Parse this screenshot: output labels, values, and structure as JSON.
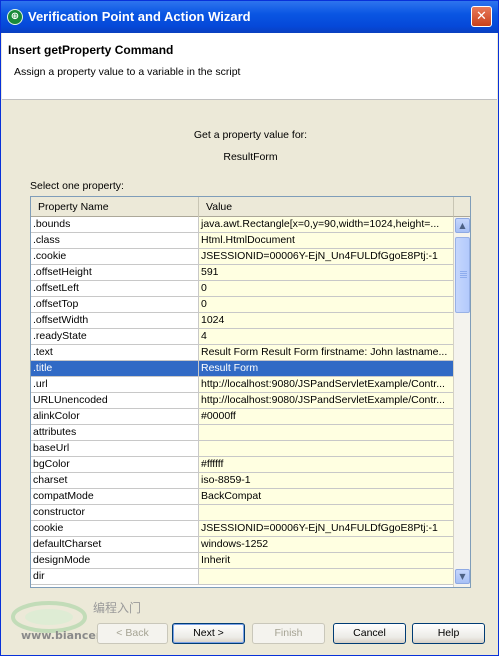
{
  "window": {
    "title": "Verification Point and Action Wizard",
    "close_glyph": "✕",
    "app_icon": "wizard-globe-icon"
  },
  "header": {
    "heading": "Insert getProperty Command",
    "description": "Assign a property value to a variable in the script"
  },
  "main": {
    "prompt": "Get a property value for:",
    "object_name": "ResultForm",
    "select_label": "Select one property:"
  },
  "table": {
    "columns": [
      "Property Name",
      "Value"
    ],
    "selected_index": 9,
    "rows": [
      {
        "name": ".bounds",
        "value": "java.awt.Rectangle[x=0,y=90,width=1024,height=..."
      },
      {
        "name": ".class",
        "value": "Html.HtmlDocument"
      },
      {
        "name": ".cookie",
        "value": "JSESSIONID=00006Y-EjN_Un4FULDfGgoE8Ptj:-1"
      },
      {
        "name": ".offsetHeight",
        "value": "591"
      },
      {
        "name": ".offsetLeft",
        "value": "0"
      },
      {
        "name": ".offsetTop",
        "value": "0"
      },
      {
        "name": ".offsetWidth",
        "value": "1024"
      },
      {
        "name": ".readyState",
        "value": "4"
      },
      {
        "name": ".text",
        "value": "Result Form Result Form firstname: John lastname..."
      },
      {
        "name": ".title",
        "value": "Result Form"
      },
      {
        "name": ".url",
        "value": "http://localhost:9080/JSPandServletExample/Contr..."
      },
      {
        "name": "URLUnencoded",
        "value": "http://localhost:9080/JSPandServletExample/Contr..."
      },
      {
        "name": "alinkColor",
        "value": "#0000ff"
      },
      {
        "name": "attributes",
        "value": ""
      },
      {
        "name": "baseUrl",
        "value": ""
      },
      {
        "name": "bgColor",
        "value": "#ffffff"
      },
      {
        "name": "charset",
        "value": "iso-8859-1"
      },
      {
        "name": "compatMode",
        "value": "BackCompat"
      },
      {
        "name": "constructor",
        "value": ""
      },
      {
        "name": "cookie",
        "value": "JSESSIONID=00006Y-EjN_Un4FULDfGgoE8Ptj:-1"
      },
      {
        "name": "defaultCharset",
        "value": "windows-1252"
      },
      {
        "name": "designMode",
        "value": "Inherit"
      },
      {
        "name": "dir",
        "value": ""
      }
    ]
  },
  "buttons": {
    "back": "< Back",
    "next": "Next >",
    "finish": "Finish",
    "cancel": "Cancel",
    "help": "Help"
  },
  "watermark": {
    "text_cn": "编程入门",
    "url": "www.biancen .cn"
  },
  "colors": {
    "titlebar": "#0a56e3",
    "selection": "#316ac5",
    "value_cell_bg": "#ffffe1"
  }
}
